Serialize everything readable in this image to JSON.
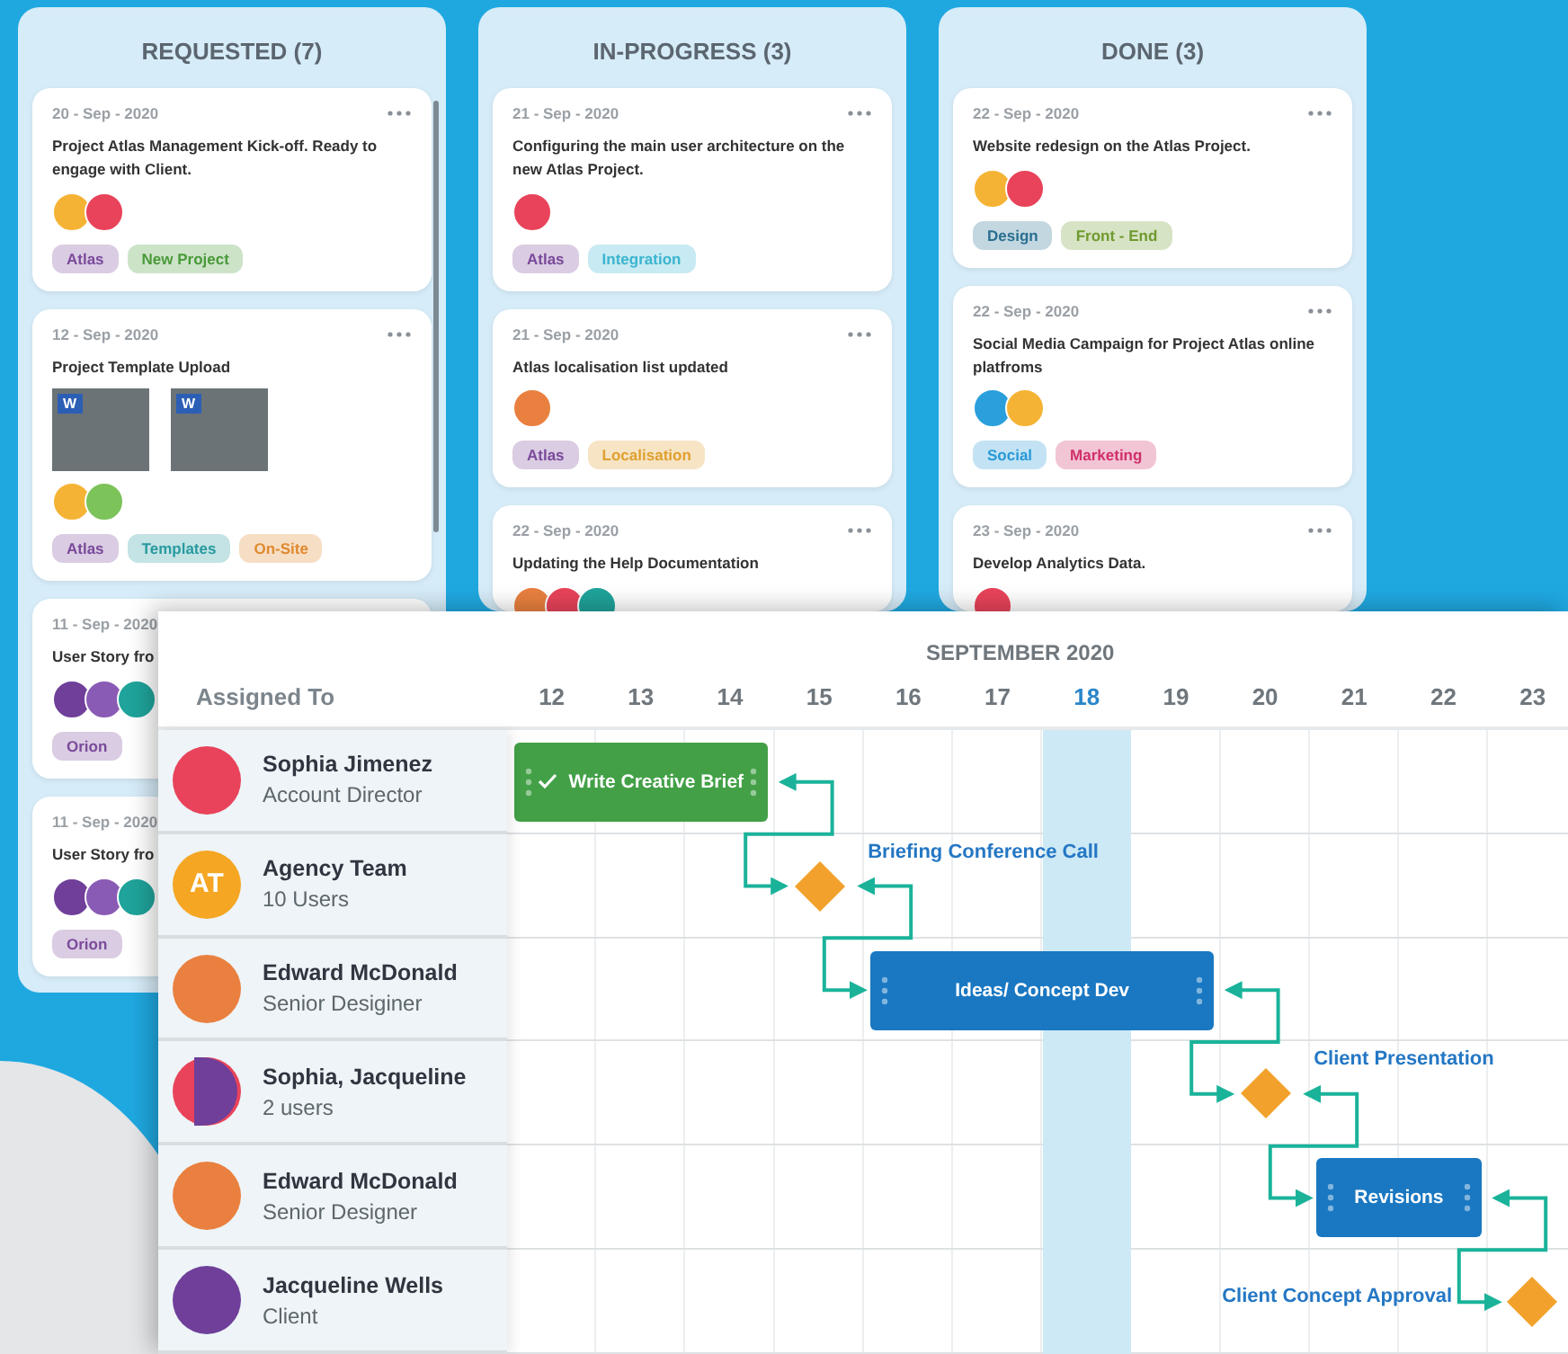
{
  "board": {
    "columns": [
      {
        "title": "REQUESTED (7)",
        "scrollbar": true,
        "cards": [
          {
            "date": "20 - Sep - 2020",
            "title": "Project Atlas Management Kick-off. Ready to engage with Client.",
            "avatars": [
              {
                "color": "#f5b335"
              },
              {
                "color": "#e8435a"
              }
            ],
            "tags": [
              {
                "label": "Atlas",
                "color": "#7a4a9a"
              },
              {
                "label": "New Project",
                "color": "#4a9a3a"
              }
            ]
          },
          {
            "date": "12 - Sep - 2020",
            "title": "Project Template Upload",
            "attachments": [
              {
                "badge": "W"
              },
              {
                "badge": "W"
              }
            ],
            "avatars": [
              {
                "color": "#f5b335"
              },
              {
                "color": "#7cc35a"
              }
            ],
            "tags": [
              {
                "label": "Atlas",
                "color": "#7a4a9a"
              },
              {
                "label": "Templates",
                "color": "#2a9aa0"
              },
              {
                "label": "On-Site",
                "color": "#e08a30"
              }
            ]
          },
          {
            "date": "11 - Sep - 2020",
            "title": "User Story fro",
            "avatars": [
              {
                "color": "#6f3f9a"
              },
              {
                "color": "#8a5bb5"
              },
              {
                "color": "#1fa39a"
              }
            ],
            "tags": [
              {
                "label": "Orion",
                "color": "#7a4a9a"
              }
            ]
          },
          {
            "date": "11 - Sep - 2020",
            "title": "User Story fro",
            "avatars": [
              {
                "color": "#6f3f9a"
              },
              {
                "color": "#8a5bb5"
              },
              {
                "color": "#1fa39a"
              }
            ],
            "tags": [
              {
                "label": "Orion",
                "color": "#7a4a9a"
              }
            ]
          }
        ]
      },
      {
        "title": "IN-PROGRESS (3)",
        "scrollbar": false,
        "cards": [
          {
            "date": "21 - Sep - 2020",
            "title": "Configuring the main user architecture on the new Atlas Project.",
            "avatars": [
              {
                "color": "#e8435a"
              }
            ],
            "tags": [
              {
                "label": "Atlas",
                "color": "#7a4a9a"
              },
              {
                "label": "Integration",
                "color": "#3bb5cf"
              }
            ]
          },
          {
            "date": "21 - Sep - 2020",
            "title": "Atlas localisation list updated",
            "avatars": [
              {
                "color": "#e9803f"
              }
            ],
            "tags": [
              {
                "label": "Atlas",
                "color": "#7a4a9a"
              },
              {
                "label": "Localisation",
                "color": "#e0a030"
              }
            ]
          },
          {
            "date": "22 - Sep - 2020",
            "title": "Updating the Help Documentation",
            "avatars": [
              {
                "color": "#e9803f"
              },
              {
                "color": "#e8435a"
              },
              {
                "color": "#1fa39a"
              }
            ]
          }
        ]
      },
      {
        "title": "DONE (3)",
        "scrollbar": false,
        "cards": [
          {
            "date": "22 - Sep - 2020",
            "title": "Website redesign on the Atlas Project.",
            "avatars": [
              {
                "color": "#f5b335"
              },
              {
                "color": "#e8435a"
              }
            ],
            "tags": [
              {
                "label": "Design",
                "color": "#2a6f90"
              },
              {
                "label": "Front - End",
                "color": "#6f9a30"
              }
            ]
          },
          {
            "date": "22 - Sep - 2020",
            "title": "Social Media Campaign for Project Atlas online platfroms",
            "avatars": [
              {
                "color": "#2b9fdc"
              },
              {
                "color": "#f5b335"
              }
            ],
            "tags": [
              {
                "label": "Social",
                "color": "#2a9ad8"
              },
              {
                "label": "Marketing",
                "color": "#d0306a"
              }
            ]
          },
          {
            "date": "23 - Sep - 2020",
            "title": "Develop Analytics Data.",
            "avatars": [
              {
                "color": "#e8435a"
              }
            ]
          }
        ]
      }
    ]
  },
  "gantt": {
    "month": "SEPTEMBER 2020",
    "assignee_heading": "Assigned To",
    "days": [
      {
        "label": "12",
        "today": false
      },
      {
        "label": "13",
        "today": false
      },
      {
        "label": "14",
        "today": false
      },
      {
        "label": "15",
        "today": false
      },
      {
        "label": "16",
        "today": false
      },
      {
        "label": "17",
        "today": false
      },
      {
        "label": "18",
        "today": true
      },
      {
        "label": "19",
        "today": false
      },
      {
        "label": "20",
        "today": false
      },
      {
        "label": "21",
        "today": false
      },
      {
        "label": "22",
        "today": false
      },
      {
        "label": "23",
        "today": false
      }
    ],
    "assignees": [
      {
        "name": "Sophia Jimenez",
        "role": "Account Director",
        "avatars": [
          {
            "color": "#e8435a"
          }
        ],
        "task": {
          "label": "Write Creative Brief",
          "color": "#43a047",
          "done": true,
          "cells": [
            {
              "kind": "bar"
            },
            {
              "kind": "bar"
            },
            {
              "kind": "bar"
            },
            {
              "kind": "empty"
            },
            {
              "kind": "empty"
            },
            {
              "kind": "empty"
            },
            {
              "kind": "empty"
            },
            {
              "kind": "empty"
            },
            {
              "kind": "empty"
            },
            {
              "kind": "empty"
            },
            {
              "kind": "empty"
            },
            {
              "kind": "empty"
            }
          ]
        }
      },
      {
        "name": "Agency Team",
        "role": "10 Users",
        "avatars": [
          {
            "color": "#f5a623",
            "initials": "AT"
          }
        ],
        "task": {
          "label": "Briefing Conference Call",
          "label_left": false,
          "cells": [
            {
              "kind": "empty"
            },
            {
              "kind": "empty"
            },
            {
              "kind": "empty"
            },
            {
              "kind": "milestone"
            },
            {
              "kind": "empty"
            },
            {
              "kind": "empty"
            },
            {
              "kind": "empty"
            },
            {
              "kind": "empty"
            },
            {
              "kind": "empty"
            },
            {
              "kind": "empty"
            },
            {
              "kind": "empty"
            },
            {
              "kind": "empty"
            }
          ]
        }
      },
      {
        "name": "Edward McDonald",
        "role": "Senior Desiginer",
        "avatars": [
          {
            "color": "#e9803f"
          }
        ],
        "task": {
          "label": "Ideas/ Concept Dev",
          "color": "#1a78c2",
          "done": false,
          "cells": [
            {
              "kind": "empty"
            },
            {
              "kind": "empty"
            },
            {
              "kind": "empty"
            },
            {
              "kind": "empty"
            },
            {
              "kind": "bar"
            },
            {
              "kind": "bar"
            },
            {
              "kind": "bar"
            },
            {
              "kind": "bar"
            },
            {
              "kind": "empty"
            },
            {
              "kind": "empty"
            },
            {
              "kind": "empty"
            },
            {
              "kind": "empty"
            }
          ]
        }
      },
      {
        "name": "Sophia, Jacqueline",
        "role": "2 users",
        "avatars": [
          {
            "color": "#e8435a"
          },
          {
            "color": "#6f3f9a"
          }
        ],
        "task": {
          "label": "Client Presentation",
          "label_left": false,
          "cells": [
            {
              "kind": "empty"
            },
            {
              "kind": "empty"
            },
            {
              "kind": "empty"
            },
            {
              "kind": "empty"
            },
            {
              "kind": "empty"
            },
            {
              "kind": "empty"
            },
            {
              "kind": "empty"
            },
            {
              "kind": "empty"
            },
            {
              "kind": "milestone"
            },
            {
              "kind": "empty"
            },
            {
              "kind": "empty"
            },
            {
              "kind": "empty"
            }
          ]
        }
      },
      {
        "name": "Edward McDonald",
        "role": "Senior Designer",
        "avatars": [
          {
            "color": "#e9803f"
          }
        ],
        "task": {
          "label": "Revisions",
          "color": "#1a78c2",
          "done": false,
          "cells": [
            {
              "kind": "empty"
            },
            {
              "kind": "empty"
            },
            {
              "kind": "empty"
            },
            {
              "kind": "empty"
            },
            {
              "kind": "empty"
            },
            {
              "kind": "empty"
            },
            {
              "kind": "empty"
            },
            {
              "kind": "empty"
            },
            {
              "kind": "empty"
            },
            {
              "kind": "bar"
            },
            {
              "kind": "bar"
            },
            {
              "kind": "empty"
            }
          ]
        }
      },
      {
        "name": "Jacqueline Wells",
        "role": "Client",
        "avatars": [
          {
            "color": "#6f3f9a"
          }
        ],
        "task": {
          "label": "Client Concept Approval",
          "label_left": true,
          "cells": [
            {
              "kind": "empty"
            },
            {
              "kind": "empty"
            },
            {
              "kind": "empty"
            },
            {
              "kind": "empty"
            },
            {
              "kind": "empty"
            },
            {
              "kind": "empty"
            },
            {
              "kind": "empty"
            },
            {
              "kind": "empty"
            },
            {
              "kind": "empty"
            },
            {
              "kind": "empty"
            },
            {
              "kind": "empty"
            },
            {
              "kind": "milestone"
            }
          ]
        }
      }
    ]
  }
}
